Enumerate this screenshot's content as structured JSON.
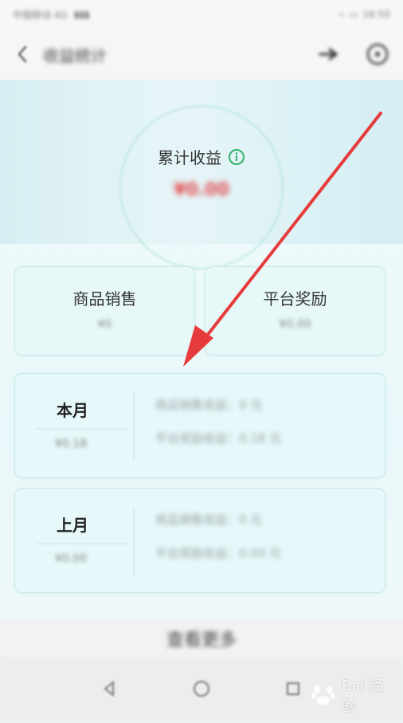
{
  "status_bar": {
    "left_text": "中国移动 4G",
    "right_text": "16:50"
  },
  "header": {
    "title": "收益统计"
  },
  "banner": {
    "total_label": "累计收益",
    "total_value": "¥0.00"
  },
  "summary": {
    "product_sales": {
      "label": "商品销售",
      "value": "¥0"
    },
    "platform_reward": {
      "label": "平台奖励",
      "value": "¥0.00"
    }
  },
  "this_month": {
    "title": "本月",
    "amount": "¥0.18",
    "line1": "商品销售收益：0 元",
    "line2": "平台奖励收益：0.18 元"
  },
  "last_month": {
    "title": "上月",
    "amount": "¥0.00",
    "line1": "商品销售收益：0 元",
    "line2": "平台奖励收益：0.00 元"
  },
  "view_more": {
    "label": "查看更多"
  },
  "watermark": {
    "text": "Bai 经验"
  },
  "colors": {
    "accent_red": "#e63b3b",
    "info_green": "#32b36b"
  }
}
